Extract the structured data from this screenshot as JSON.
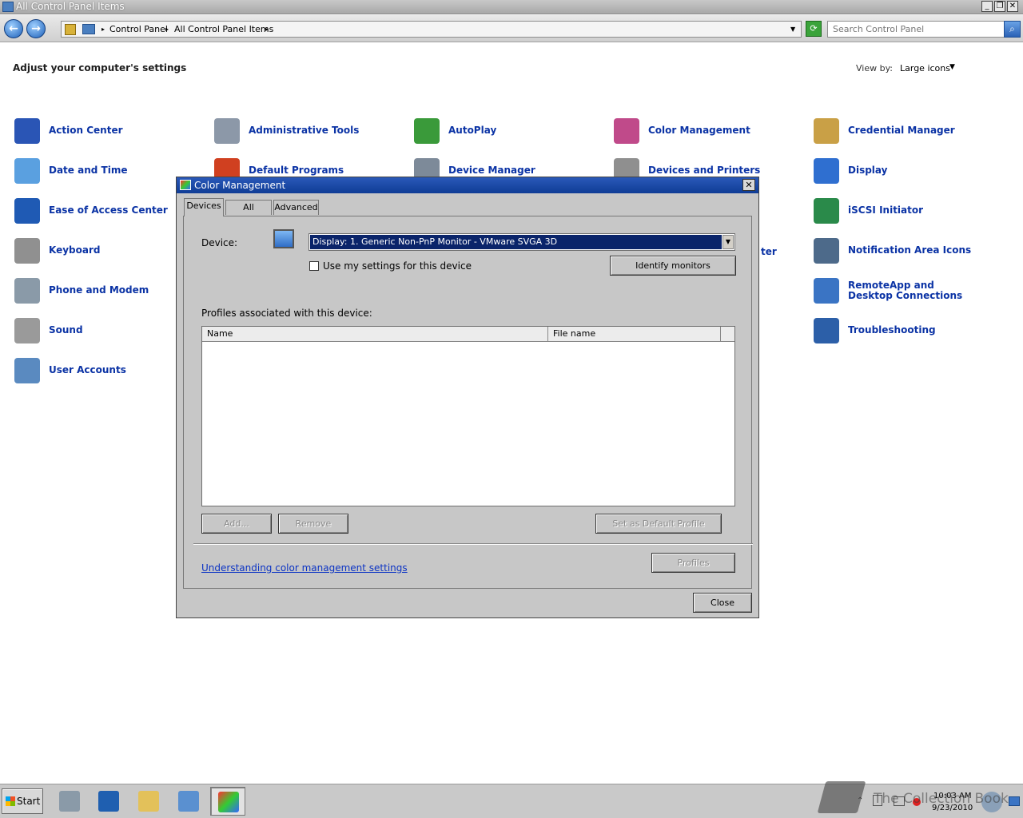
{
  "window": {
    "title": "All Control Panel Items",
    "minimize": "_",
    "restore": "❐",
    "close": "✕"
  },
  "address": {
    "back": "←",
    "forward": "→",
    "crumbs": [
      "Control Panel",
      "All Control Panel Items"
    ],
    "separator": "▸",
    "search_placeholder": "Search Control Panel"
  },
  "content": {
    "heading": "Adjust your computer's settings",
    "view_by_label": "View by:",
    "view_by_value": "Large icons",
    "items": [
      {
        "label": "Action Center",
        "icon": "flag-icon",
        "color": "#2a55b5"
      },
      {
        "label": "Administrative Tools",
        "icon": "gears-icon",
        "color": "#8c98a8"
      },
      {
        "label": "AutoPlay",
        "icon": "autoplay-icon",
        "color": "#3a9a3a"
      },
      {
        "label": "Color Management",
        "icon": "color-monitor-icon",
        "color": "#c04a8a"
      },
      {
        "label": "Credential Manager",
        "icon": "vault-icon",
        "color": "#c9a046"
      },
      {
        "label": "Date and Time",
        "icon": "calendar-clock-icon",
        "color": "#5aa0e0"
      },
      {
        "label": "Default Programs",
        "icon": "default-programs-icon",
        "color": "#d04020"
      },
      {
        "label": "Device Manager",
        "icon": "device-manager-icon",
        "color": "#7d8a99"
      },
      {
        "label": "Devices and Printers",
        "icon": "printer-icon",
        "color": "#8f8f8f"
      },
      {
        "label": "Display",
        "icon": "display-icon",
        "color": "#2f6fd0"
      },
      {
        "label": "Ease of Access Center",
        "icon": "ease-of-access-icon",
        "color": "#1f5ab4"
      },
      {
        "label": "iSCSI Initiator",
        "icon": "globe-icon",
        "color": "#2a8a4a"
      },
      {
        "label": "Keyboard",
        "icon": "keyboard-icon",
        "color": "#909090"
      },
      {
        "label": "Notification Area Icons",
        "icon": "notification-area-icon",
        "color": "#4d6a8a"
      },
      {
        "label": "Phone and Modem",
        "icon": "phone-icon",
        "color": "#8a9aa8"
      },
      {
        "label": "RemoteApp and Desktop Connections",
        "icon": "remote-desktop-icon",
        "color": "#3a74c4"
      },
      {
        "label": "Sound",
        "icon": "speaker-icon",
        "color": "#9a9a9a"
      },
      {
        "label": "Troubleshooting",
        "icon": "troubleshooting-icon",
        "color": "#2c5fa8"
      },
      {
        "label": "User Accounts",
        "icon": "users-icon",
        "color": "#5a8ac0"
      }
    ],
    "partial_label": "ter"
  },
  "dialog": {
    "title": "Color Management",
    "close_x": "✕",
    "tabs": [
      "Devices",
      "All Profiles",
      "Advanced"
    ],
    "device_label": "Device:",
    "device_value": "Display: 1. Generic Non-PnP Monitor - VMware SVGA 3D",
    "use_settings_label": "Use my settings for this device",
    "identify_button": "Identify monitors",
    "profiles_label": "Profiles associated with this device:",
    "columns": [
      "Name",
      "File name"
    ],
    "add_button": "Add...",
    "remove_button": "Remove",
    "set_default_button": "Set as Default Profile",
    "help_link": "Understanding color management settings",
    "profiles_button": "Profiles",
    "close_button": "Close"
  },
  "taskbar": {
    "start_label": "Start",
    "time": "10:03 AM",
    "date": "9/23/2010",
    "watermark": "The Collection Book"
  }
}
